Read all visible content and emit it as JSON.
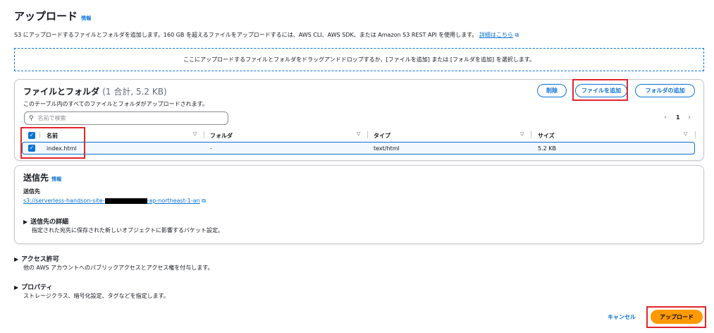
{
  "header": {
    "title": "アップロード",
    "info": "情報",
    "description": "S3 にアップロードするファイルとフォルダを追加します。160 GB を超えるファイルをアップロードするには、AWS CLI、AWS SDK、または Amazon S3 REST API を使用します。",
    "details_link": "詳細はこちら"
  },
  "dropzone": {
    "text": "ここにアップロードするファイルとフォルダをドラッグアンドドロップするか、[ファイルを追加] または [フォルダを追加] を選択します。"
  },
  "files_panel": {
    "title": "ファイルとフォルダ",
    "count": "(1 合計, 5.2 KB)",
    "subtitle": "このテーブル内のすべてのファイルとフォルダがアップロードされます。",
    "delete_label": "削除",
    "add_files_label": "ファイルを追加",
    "add_folder_label": "フォルダの追加",
    "search_placeholder": "名前で検索",
    "page_number": "1",
    "columns": [
      "名前",
      "フォルダ",
      "タイプ",
      "サイズ"
    ],
    "rows": [
      {
        "name": "index.html",
        "folder": "-",
        "type": "text/html",
        "size": "5.2 KB"
      }
    ]
  },
  "destination": {
    "title": "送信先",
    "info": "情報",
    "label": "送信先",
    "url_prefix": "s3://serverless-handson-site-",
    "url_suffix": "-ap-northeast-1-an",
    "details_title": "送信先の詳細",
    "details_desc": "指定された宛先に保存された新しいオブジェクトに影響するバケット設定。"
  },
  "permissions": {
    "title": "アクセス許可",
    "desc": "他の AWS アカウントへのパブリックアクセスとアクセス権を付与します。"
  },
  "properties": {
    "title": "プロパティ",
    "desc": "ストレージクラス、暗号化設定、タグなどを指定します。"
  },
  "footer": {
    "cancel_label": "キャンセル",
    "upload_label": "アップロード"
  },
  "colors": {
    "accent": "#0972d3",
    "upload_button": "#ff9900",
    "highlight_box": "#e0262d"
  }
}
